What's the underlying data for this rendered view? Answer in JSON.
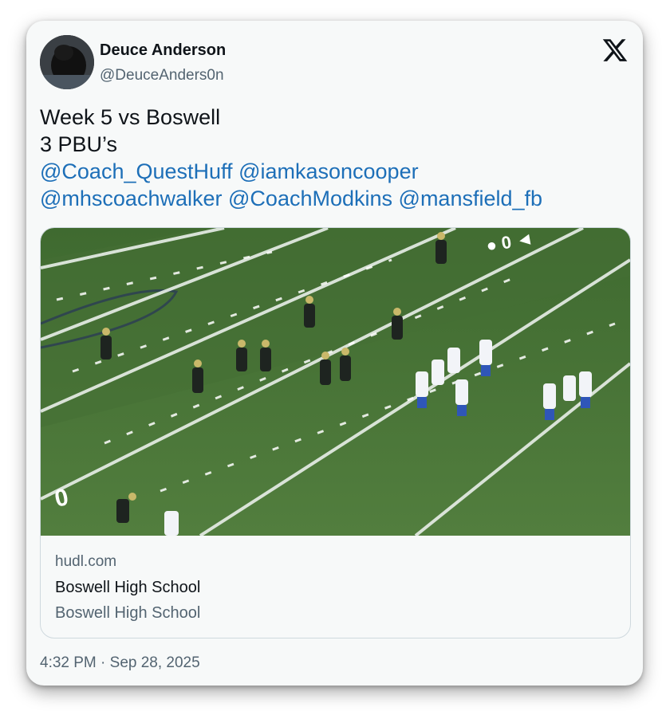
{
  "author": {
    "display_name": "Deuce Anderson",
    "handle": "@DeuceAnders0n"
  },
  "tweet": {
    "lines": [
      "Week 5 vs Boswell",
      "3 PBU’s"
    ],
    "mentions": [
      "@Coach_QuestHuff",
      "@iamkasoncooper",
      "@mhscoachwalker",
      "@CoachModkins",
      "@mansfield_fb"
    ]
  },
  "link_card": {
    "domain": "hudl.com",
    "title": "Boswell High School",
    "description": "Boswell High School"
  },
  "timestamp": "4:32 PM · Sep 28, 2025",
  "icons": {
    "brand": "x-logo-icon",
    "avatar": "avatar-image"
  },
  "colors": {
    "mention": "#1d6fb8",
    "field_green": "#4f7a3a",
    "secondary_text": "#536471"
  }
}
